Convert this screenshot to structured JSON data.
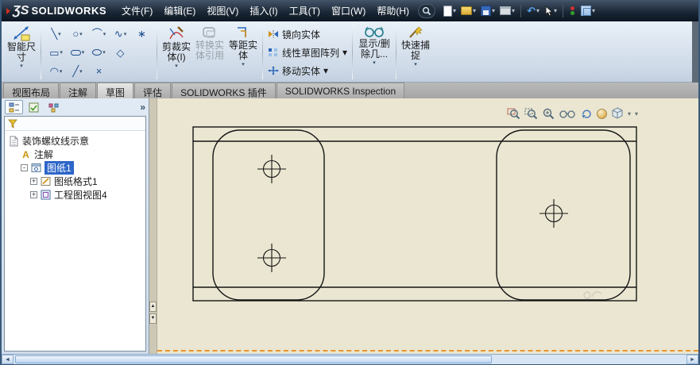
{
  "titlebar": {
    "logo_mark": "ƷS",
    "logo_text": "SOLIDWORKS",
    "menus": [
      "文件(F)",
      "编辑(E)",
      "视图(V)",
      "插入(I)",
      "工具(T)",
      "窗口(W)",
      "帮助(H)"
    ]
  },
  "ribbon": {
    "smart_dimension": "智能尺寸",
    "trim_entities": "剪裁实体(I)",
    "convert_entities": "转换实体引用",
    "offset_entities": "等距实体",
    "mirror_entities": "镜向实体",
    "linear_sketch_pattern": "线性草图阵列",
    "move_entities": "移动实体",
    "display_delete_relations": "显示/删除几...",
    "quick_snaps": "快速捕捉"
  },
  "tabs": [
    {
      "label": "视图布局"
    },
    {
      "label": "注解"
    },
    {
      "label": "草图"
    },
    {
      "label": "评估"
    },
    {
      "label": "SOLIDWORKS 插件"
    },
    {
      "label": "SOLIDWORKS Inspection"
    }
  ],
  "feature_tree": {
    "root": "装饰螺纹线示意",
    "annotations": "注解",
    "sheet": "图纸1",
    "sheet_format": "图纸格式1",
    "drawing_view": "工程图视图4",
    "annotation_letter": "A"
  },
  "sketch_tools": {
    "glyphs": [
      "╲",
      "○",
      "⌒",
      "∿",
      "∗",
      "▭",
      "◇",
      "◠",
      "╱",
      "×"
    ]
  },
  "ui": {
    "caret": "▾",
    "chevrons": "»",
    "plus": "+",
    "minus": "-",
    "undo": "↶",
    "left": "◄",
    "right": "►",
    "up": "▲",
    "down": "▼"
  },
  "colors": {
    "canvas_bg": "#eae6d1",
    "selection_blue": "#2e66c9",
    "sheet_border_orange": "#e8962e",
    "titlebar_dark": "#1b2836"
  }
}
